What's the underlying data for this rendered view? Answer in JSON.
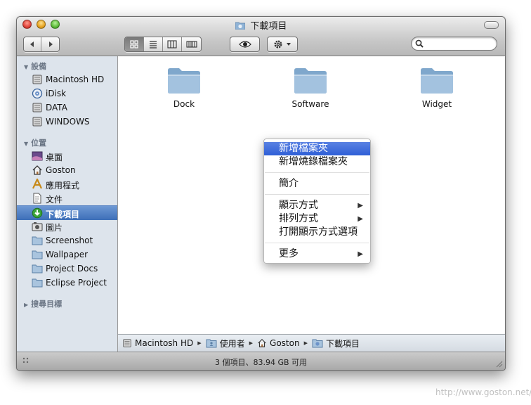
{
  "window": {
    "title": "下載項目",
    "title_icon": "downloads-folder-icon"
  },
  "toolbar": {
    "back_icon": "back-arrow-icon",
    "forward_icon": "forward-arrow-icon",
    "views": [
      {
        "name": "icon-view-icon",
        "active": true
      },
      {
        "name": "list-view-icon",
        "active": false
      },
      {
        "name": "column-view-icon",
        "active": false
      },
      {
        "name": "coverflow-view-icon",
        "active": false
      }
    ],
    "quicklook_icon": "eye-icon",
    "action_icon": "gear-icon",
    "search": {
      "value": "",
      "placeholder": ""
    }
  },
  "sidebar": {
    "devices_header": "設備",
    "devices": [
      {
        "label": "Macintosh HD",
        "icon": "hard-disk-icon"
      },
      {
        "label": "iDisk",
        "icon": "idisk-icon"
      },
      {
        "label": "DATA",
        "icon": "hard-disk-icon"
      },
      {
        "label": "WINDOWS",
        "icon": "hard-disk-icon"
      }
    ],
    "places_header": "位置",
    "places": [
      {
        "label": "桌面",
        "icon": "desktop-icon"
      },
      {
        "label": "Goston",
        "icon": "home-icon"
      },
      {
        "label": "應用程式",
        "icon": "applications-icon"
      },
      {
        "label": "文件",
        "icon": "documents-icon"
      },
      {
        "label": "下載項目",
        "icon": "downloads-icon",
        "selected": true
      },
      {
        "label": "圖片",
        "icon": "pictures-icon"
      },
      {
        "label": "Screenshot",
        "icon": "folder-icon"
      },
      {
        "label": "Wallpaper",
        "icon": "folder-icon"
      },
      {
        "label": "Project Docs",
        "icon": "folder-icon"
      },
      {
        "label": "Eclipse Project",
        "icon": "folder-icon"
      }
    ],
    "search_header": "搜尋目標"
  },
  "files": [
    {
      "name": "Dock",
      "icon": "folder-icon"
    },
    {
      "name": "Software",
      "icon": "folder-icon"
    },
    {
      "name": "Widget",
      "icon": "folder-icon"
    }
  ],
  "context_menu": {
    "items": [
      {
        "label": "新增檔案夾",
        "highlighted": true
      },
      {
        "label": "新增燒錄檔案夾"
      },
      {
        "label": "簡介"
      },
      {
        "label": "顯示方式",
        "submenu": true
      },
      {
        "label": "排列方式",
        "submenu": true
      },
      {
        "label": "打開顯示方式選項"
      },
      {
        "label": "更多",
        "submenu": true
      }
    ]
  },
  "pathbar": {
    "crumbs": [
      {
        "label": "Macintosh HD",
        "icon": "hard-disk-icon"
      },
      {
        "label": "使用者",
        "icon": "users-folder-icon"
      },
      {
        "label": "Goston",
        "icon": "home-icon"
      },
      {
        "label": "下載項目",
        "icon": "downloads-folder-icon"
      }
    ]
  },
  "status": {
    "text": "3 個項目、83.94 GB 可用"
  },
  "watermark": "http://www.goston.net/",
  "colors": {
    "selection": "#3d6fb8",
    "menu_highlight": "#2f5fd6",
    "sidebar_bg": "#dde4ec"
  }
}
